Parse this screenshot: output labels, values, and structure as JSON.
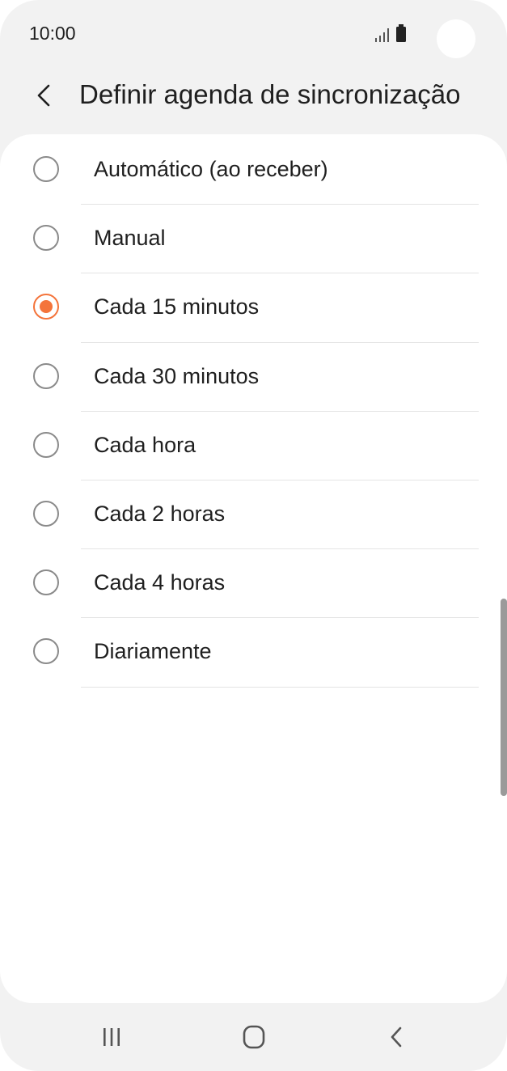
{
  "status_bar": {
    "time": "10:00"
  },
  "header": {
    "title": "Definir agenda de sincronização",
    "back_icon": "chevron-left-icon"
  },
  "options": [
    {
      "label": "Automático (ao receber)",
      "selected": false
    },
    {
      "label": "Manual",
      "selected": false
    },
    {
      "label": "Cada 15 minutos",
      "selected": true
    },
    {
      "label": "Cada 30 minutos",
      "selected": false
    },
    {
      "label": "Cada hora",
      "selected": false
    },
    {
      "label": "Cada 2 horas",
      "selected": false
    },
    {
      "label": "Cada 4 horas",
      "selected": false
    },
    {
      "label": "Diariamente",
      "selected": false
    }
  ],
  "nav_bar": {
    "recents_icon": "recents-icon",
    "home_icon": "home-icon",
    "back_icon": "back-icon"
  },
  "colors": {
    "accent": "#f4743b",
    "background": "#f2f2f2",
    "card": "#ffffff",
    "text": "#1f1f1f"
  }
}
